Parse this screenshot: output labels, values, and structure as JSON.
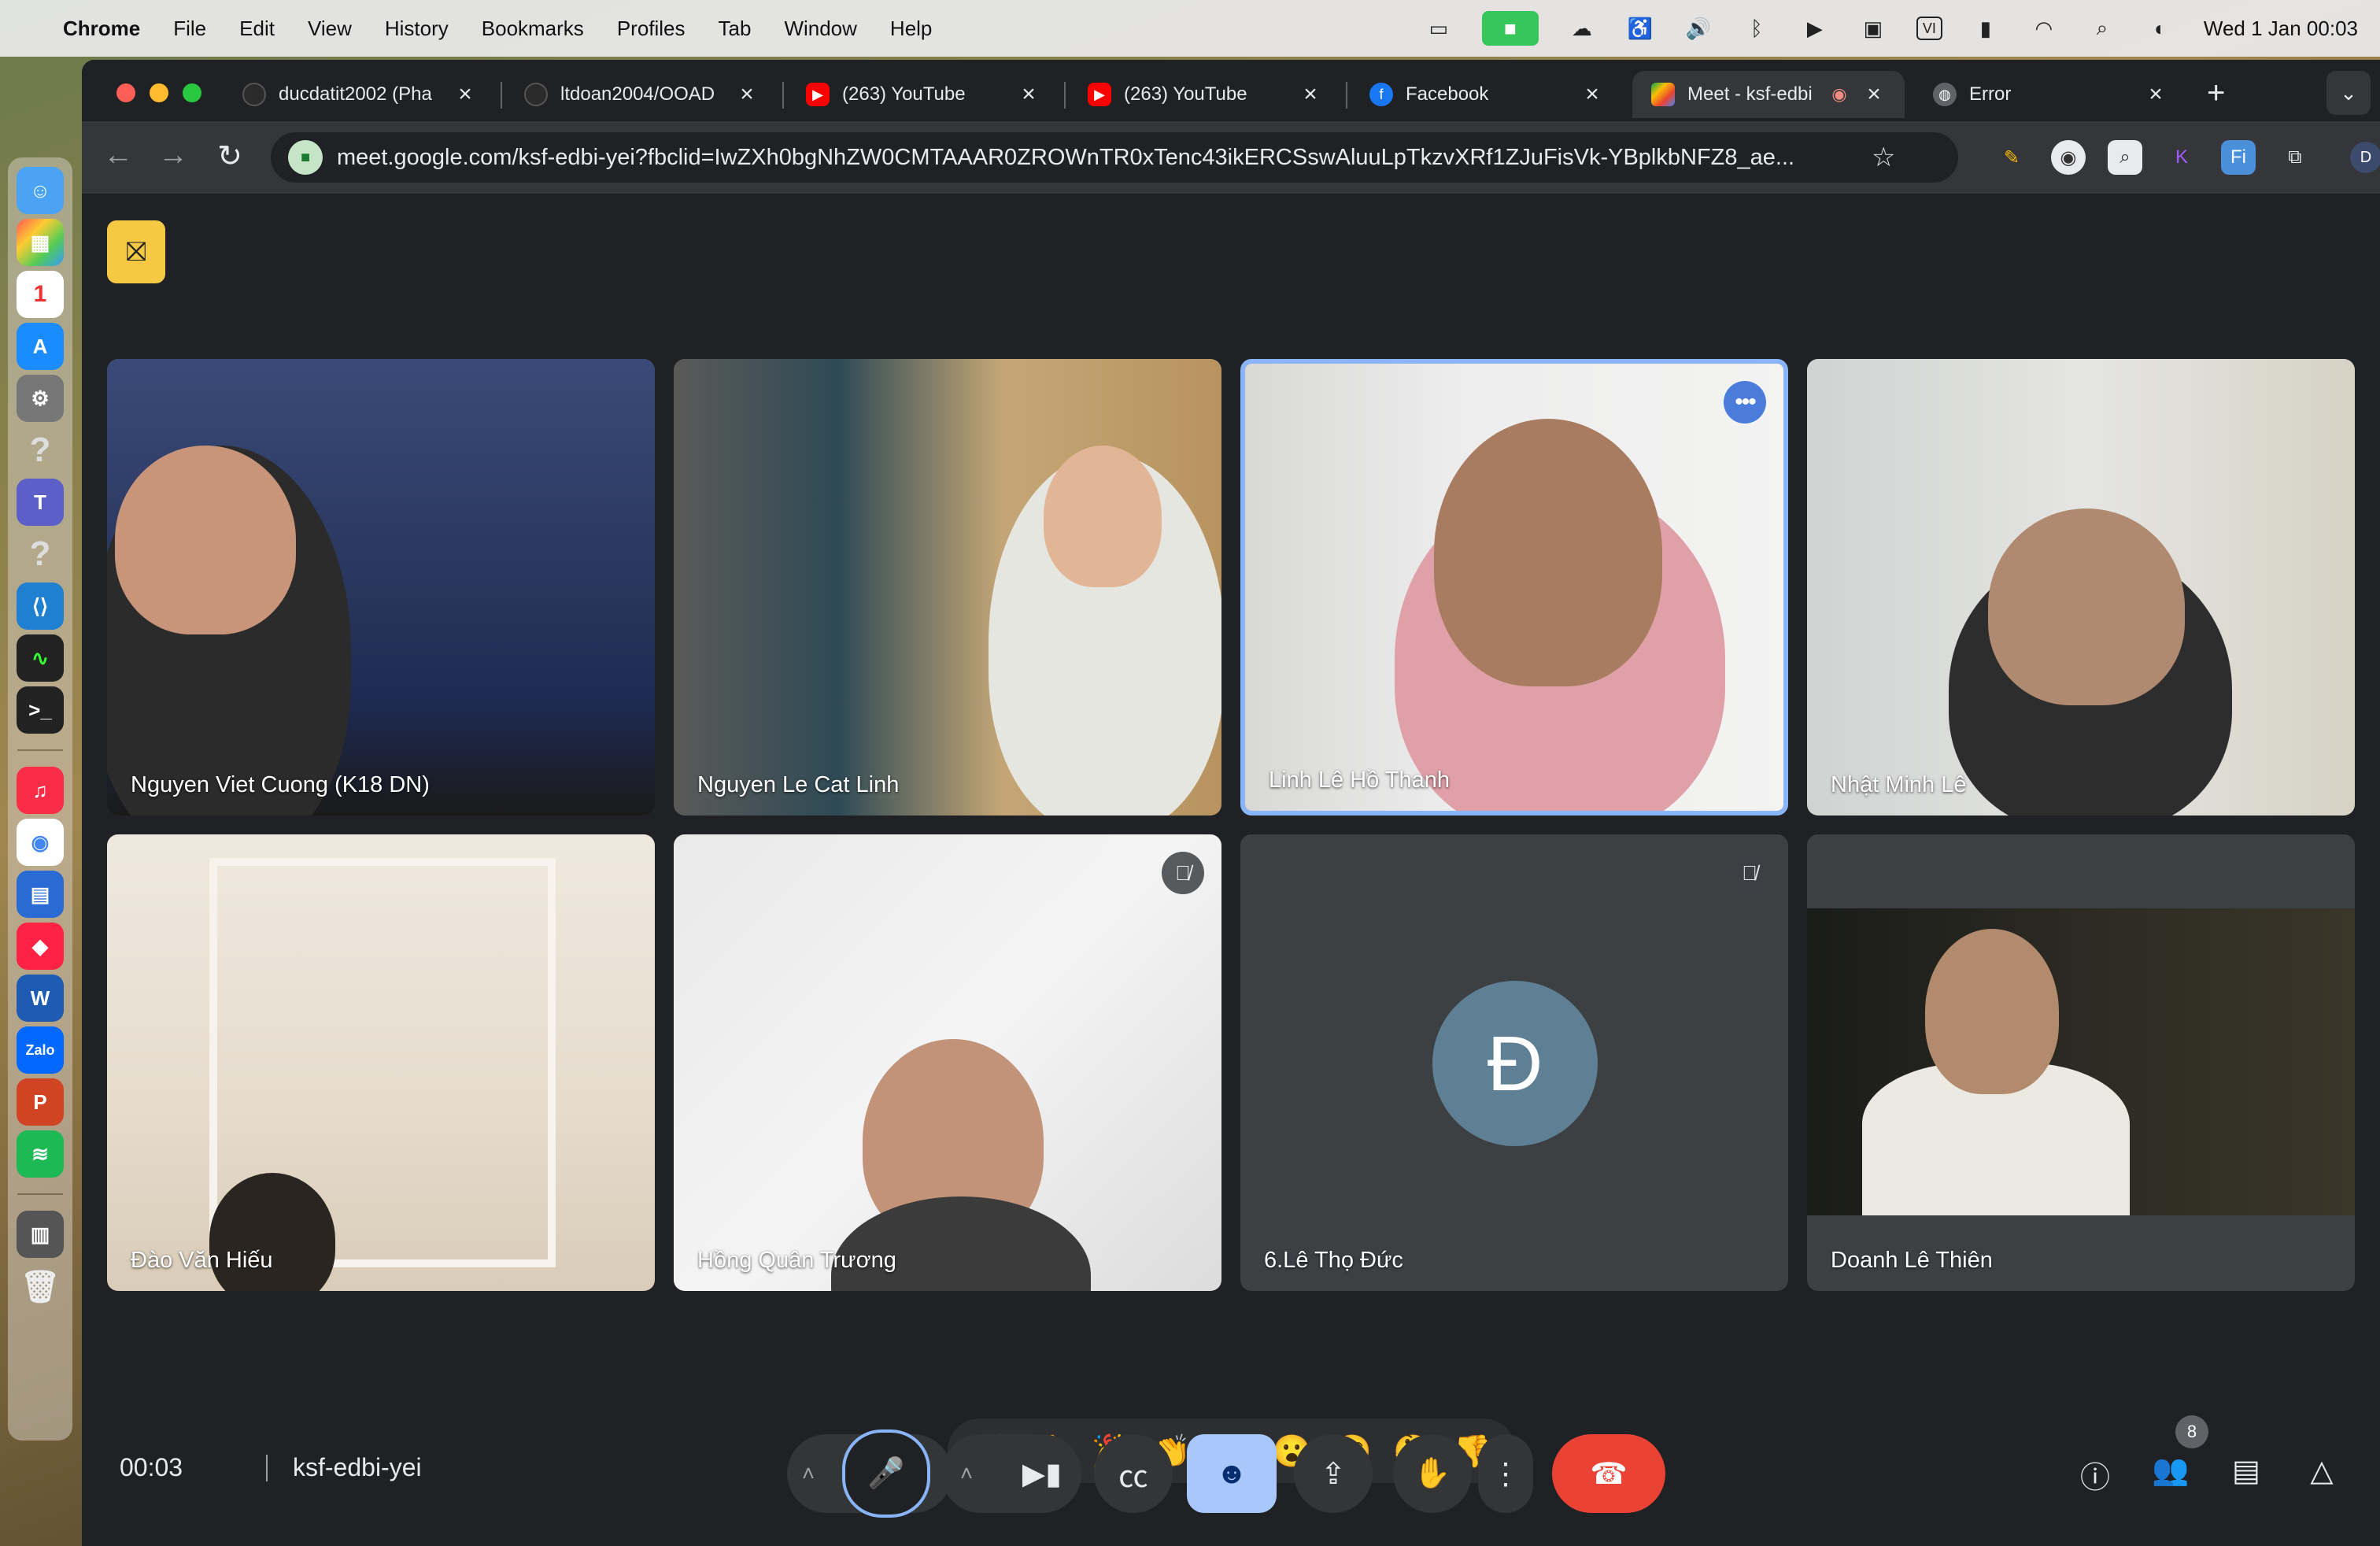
{
  "menubar": {
    "app_name": "Chrome",
    "items": [
      "File",
      "Edit",
      "View",
      "History",
      "Bookmarks",
      "Profiles",
      "Tab",
      "Window",
      "Help"
    ],
    "input_source": "VI",
    "datetime": "Wed 1 Jan  00:03"
  },
  "tabs": [
    {
      "label": "ducdatit2002 (Pha",
      "icon": "github-icon"
    },
    {
      "label": "ltdoan2004/OOAD",
      "icon": "github-icon"
    },
    {
      "label": "(263) YouTube",
      "icon": "youtube-icon"
    },
    {
      "label": "(263) YouTube",
      "icon": "youtube-icon"
    },
    {
      "label": "Facebook",
      "icon": "facebook-icon"
    },
    {
      "label": "Meet - ksf-edbi",
      "icon": "meet-icon"
    },
    {
      "label": "Error",
      "icon": "globe-icon"
    }
  ],
  "address_bar": {
    "url": "meet.google.com/ksf-edbi-yei?fbclid=IwZXh0bgNhZW0CMTAAAR0ZROWnTR0xTenc43ikERCSswAluuLpTkzvXRf1ZJuFisVk-YBplkbNFZ8_ae..."
  },
  "profile_initial": "D",
  "participants": [
    {
      "name": "Nguyen Viet Cuong (K18 DN)",
      "muted": false,
      "speaking": false
    },
    {
      "name": "Nguyen Le Cat Linh",
      "muted": false,
      "speaking": false
    },
    {
      "name": "Linh Lê Hồ Thanh",
      "muted": false,
      "speaking": true
    },
    {
      "name": "Nhật Minh Lê",
      "muted": false,
      "speaking": false
    },
    {
      "name": "Đào Văn Hiếu",
      "muted": false,
      "speaking": false
    },
    {
      "name": "Hồng Quân Trương",
      "muted": true,
      "speaking": false
    },
    {
      "name": "6.Lê Thọ Đức",
      "muted": true,
      "speaking": false,
      "avatar_letter": "Đ"
    },
    {
      "name": "Doanh Lê Thiên",
      "muted": false,
      "speaking": false
    }
  ],
  "reactions": [
    "💖",
    "👍",
    "🎉",
    "👏",
    "😂",
    "😮",
    "😢",
    "🤔",
    "👎"
  ],
  "meeting": {
    "elapsed": "00:03",
    "code": "ksf-edbi-yei",
    "participant_count": "8"
  },
  "colors": {
    "meet_bg": "#202124",
    "speaking_border": "#8ab4f8",
    "end_call": "#ea4335",
    "emoji_active": "#a8c7fa",
    "camera_off_badge": "#f6c945"
  }
}
